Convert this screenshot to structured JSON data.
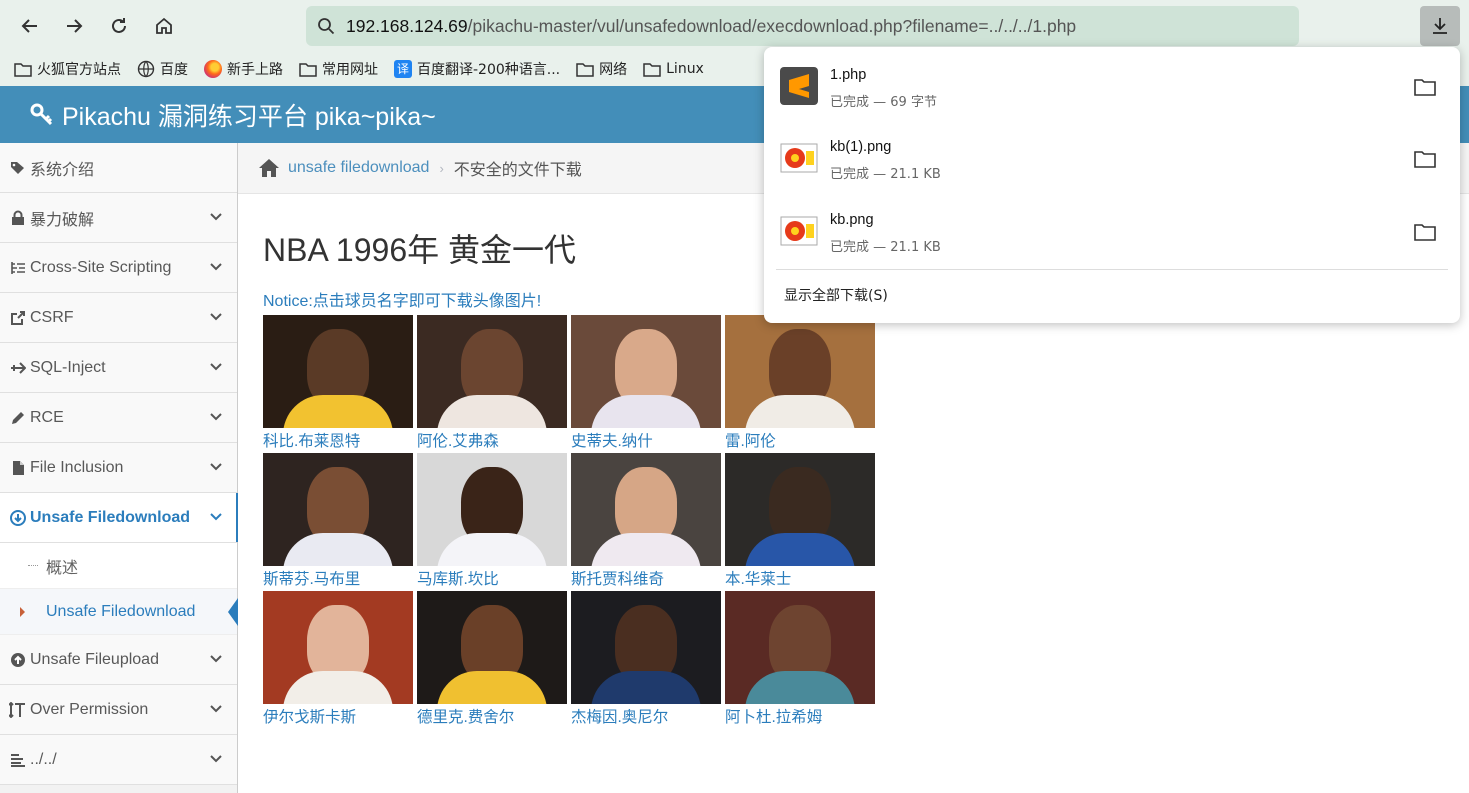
{
  "browser": {
    "url_host": "192.168.124.69",
    "url_path": "/pikachu-master/vul/unsafedownload/execdownload.php?filename=../../../1.php",
    "bookmarks": [
      "火狐官方站点",
      "百度",
      "新手上路",
      "常用网址",
      "百度翻译-200种语言...",
      "网络",
      "Linux"
    ]
  },
  "header": {
    "title": "Pikachu 漏洞练习平台 pika~pika~"
  },
  "sidebar": {
    "items": [
      {
        "label": "系统介绍"
      },
      {
        "label": "暴力破解"
      },
      {
        "label": "Cross-Site Scripting"
      },
      {
        "label": "CSRF"
      },
      {
        "label": "SQL-Inject"
      },
      {
        "label": "RCE"
      },
      {
        "label": "File Inclusion"
      },
      {
        "label": "Unsafe Filedownload"
      },
      {
        "label": "Unsafe Fileupload"
      },
      {
        "label": "Over Permission"
      },
      {
        "label": "../../"
      }
    ],
    "sub_items": [
      "概述",
      "Unsafe Filedownload"
    ]
  },
  "breadcrumb": {
    "link": "unsafe filedownload",
    "current": "不安全的文件下载"
  },
  "main": {
    "title": "NBA 1996年 黄金一代",
    "notice": "Notice:点击球员名字即可下载头像图片!",
    "players": [
      "科比.布莱恩特",
      "阿伦.艾弗森",
      "史蒂夫.纳什",
      "雷.阿伦",
      "斯蒂芬.马布里",
      "马库斯.坎比",
      "斯托贾科维奇",
      "本.华莱士",
      "伊尔戈斯卡斯",
      "德里克.费舍尔",
      "杰梅因.奥尼尔",
      "阿卜杜.拉希姆"
    ]
  },
  "downloads": {
    "items": [
      {
        "name": "1.php",
        "status": "已完成 — 69 字节"
      },
      {
        "name": "kb(1).png",
        "status": "已完成 — 21.1 KB"
      },
      {
        "name": "kb.png",
        "status": "已完成 — 21.1 KB"
      }
    ],
    "show_all": "显示全部下载(S)"
  },
  "colors": {
    "header": "#438eb9",
    "link": "#2b7dbc",
    "chrome": "#e9f1ec"
  }
}
